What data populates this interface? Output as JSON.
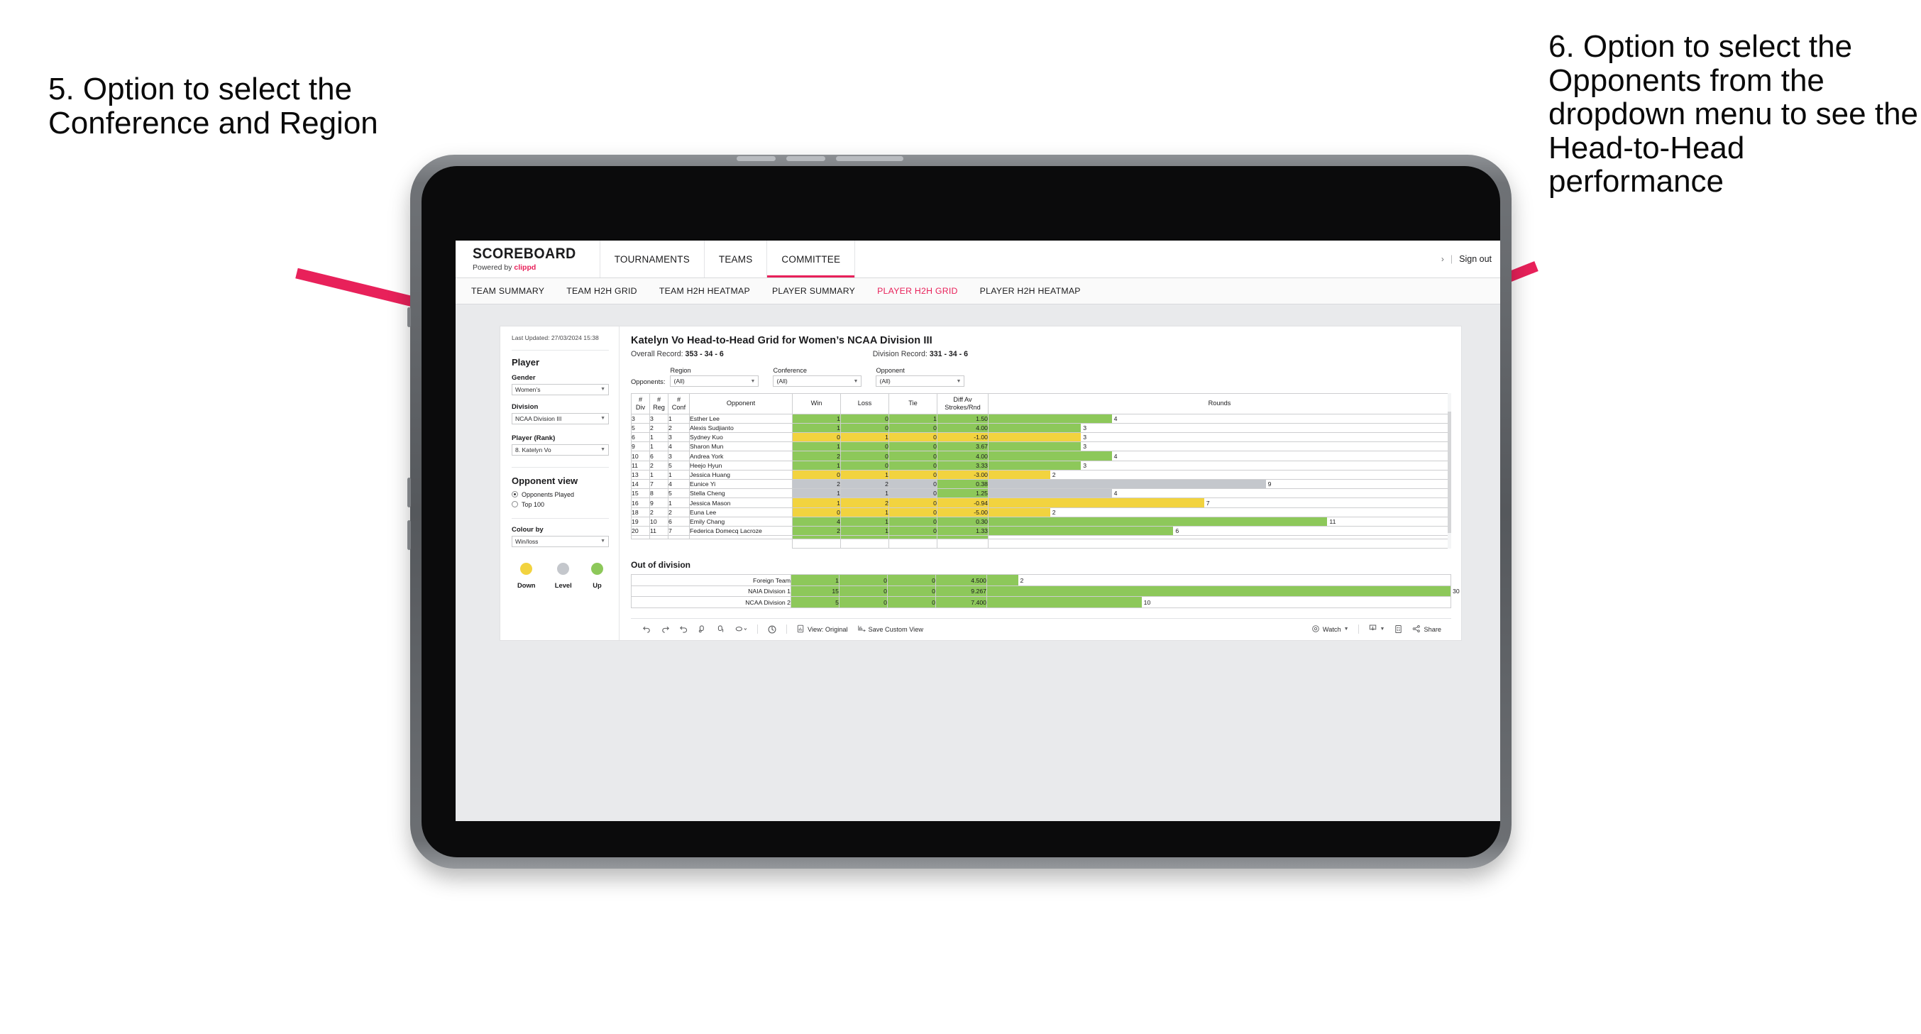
{
  "annotations": {
    "left": "5. Option to select the Conference and Region",
    "right": "6. Option to select the Opponents from the dropdown menu to see the Head-to-Head performance",
    "arrow_color": "#e8215a"
  },
  "header": {
    "brand_title": "SCOREBOARD",
    "brand_sub_prefix": "Powered by ",
    "brand_sub_accent": "clippd",
    "nav": [
      {
        "label": "TOURNAMENTS",
        "active": false
      },
      {
        "label": "TEAMS",
        "active": false
      },
      {
        "label": "COMMITTEE",
        "active": true
      }
    ],
    "user_caret": "›",
    "separator": "|",
    "sign_out": "Sign out"
  },
  "sub_nav": [
    {
      "label": "TEAM SUMMARY",
      "active": false
    },
    {
      "label": "TEAM H2H GRID",
      "active": false
    },
    {
      "label": "TEAM H2H HEATMAP",
      "active": false
    },
    {
      "label": "PLAYER SUMMARY",
      "active": false
    },
    {
      "label": "PLAYER H2H GRID",
      "active": true
    },
    {
      "label": "PLAYER H2H HEATMAP",
      "active": false
    }
  ],
  "panel": {
    "last_updated": "Last Updated: 27/03/2024 15:38",
    "section_player": "Player",
    "gender": {
      "label": "Gender",
      "value": "Women’s"
    },
    "division": {
      "label": "Division",
      "value": "NCAA Division III"
    },
    "player_rank": {
      "label": "Player (Rank)",
      "value": "8. Katelyn Vo"
    },
    "opponent_view": {
      "label": "Opponent view",
      "options": [
        {
          "label": "Opponents Played",
          "selected": true
        },
        {
          "label": "Top 100",
          "selected": false
        }
      ]
    },
    "colour_by": {
      "label": "Colour by",
      "value": "Win/loss"
    },
    "legend": [
      {
        "label": "Down",
        "color": "#f2d33f"
      },
      {
        "label": "Level",
        "color": "#c4c7cc"
      },
      {
        "label": "Up",
        "color": "#8dc85a"
      }
    ]
  },
  "viz": {
    "title": "Katelyn Vo Head-to-Head Grid for Women’s NCAA Division III",
    "overall_record_label": "Overall Record:",
    "overall_record_value": "353 -  34 - 6",
    "division_record_label": "Division Record:",
    "division_record_value": "331 -  34 - 6",
    "opponents_label": "Opponents:",
    "filters": [
      {
        "label": "Region",
        "value": "(All)"
      },
      {
        "label": "Conference",
        "value": "(All)"
      },
      {
        "label": "Opponent",
        "value": "(All)"
      }
    ]
  },
  "chart_data": {
    "type": "table",
    "title": "Katelyn Vo Head-to-Head Grid for Women’s NCAA Division III",
    "columns": [
      "# Div",
      "# Reg",
      "# Conf",
      "Opponent",
      "Win",
      "Loss",
      "Tie",
      "Diff Av Strokes/Rnd",
      "Rounds"
    ],
    "column_header_lines": [
      [
        "#",
        "Div"
      ],
      [
        "#",
        "Reg"
      ],
      [
        "#",
        "Conf"
      ],
      [
        "Opponent"
      ],
      [
        "Win"
      ],
      [
        "Loss"
      ],
      [
        "Tie"
      ],
      [
        "Diff Av",
        "Strokes/Rnd"
      ],
      [
        "Rounds"
      ]
    ],
    "rounds_max": 30,
    "rows": [
      {
        "div": "3",
        "reg": "3",
        "conf": "1",
        "opponent": "Esther Lee",
        "win": "1",
        "loss": "0",
        "tie": "1",
        "diff": "1.50",
        "rounds": "4",
        "status": "up"
      },
      {
        "div": "5",
        "reg": "2",
        "conf": "2",
        "opponent": "Alexis Sudjianto",
        "win": "1",
        "loss": "0",
        "tie": "0",
        "diff": "4.00",
        "rounds": "3",
        "status": "up"
      },
      {
        "div": "6",
        "reg": "1",
        "conf": "3",
        "opponent": "Sydney Kuo",
        "win": "0",
        "loss": "1",
        "tie": "0",
        "diff": "-1.00",
        "rounds": "3",
        "status": "down"
      },
      {
        "div": "9",
        "reg": "1",
        "conf": "4",
        "opponent": "Sharon Mun",
        "win": "1",
        "loss": "0",
        "tie": "0",
        "diff": "3.67",
        "rounds": "3",
        "status": "up"
      },
      {
        "div": "10",
        "reg": "6",
        "conf": "3",
        "opponent": "Andrea York",
        "win": "2",
        "loss": "0",
        "tie": "0",
        "diff": "4.00",
        "rounds": "4",
        "status": "up"
      },
      {
        "div": "11",
        "reg": "2",
        "conf": "5",
        "opponent": "Heejo Hyun",
        "win": "1",
        "loss": "0",
        "tie": "0",
        "diff": "3.33",
        "rounds": "3",
        "status": "up"
      },
      {
        "div": "13",
        "reg": "1",
        "conf": "1",
        "opponent": "Jessica Huang",
        "win": "0",
        "loss": "1",
        "tie": "0",
        "diff": "-3.00",
        "rounds": "2",
        "status": "down"
      },
      {
        "div": "14",
        "reg": "7",
        "conf": "4",
        "opponent": "Eunice Yi",
        "win": "2",
        "loss": "2",
        "tie": "0",
        "diff": "0.38",
        "rounds": "9",
        "status": "level",
        "diff_status": "up"
      },
      {
        "div": "15",
        "reg": "8",
        "conf": "5",
        "opponent": "Stella Cheng",
        "win": "1",
        "loss": "1",
        "tie": "0",
        "diff": "1.25",
        "rounds": "4",
        "status": "level",
        "diff_status": "up"
      },
      {
        "div": "16",
        "reg": "9",
        "conf": "1",
        "opponent": "Jessica Mason",
        "win": "1",
        "loss": "2",
        "tie": "0",
        "diff": "-0.94",
        "rounds": "7",
        "status": "down"
      },
      {
        "div": "18",
        "reg": "2",
        "conf": "2",
        "opponent": "Euna Lee",
        "win": "0",
        "loss": "1",
        "tie": "0",
        "diff": "-5.00",
        "rounds": "2",
        "status": "down"
      },
      {
        "div": "19",
        "reg": "10",
        "conf": "6",
        "opponent": "Emily Chang",
        "win": "4",
        "loss": "1",
        "tie": "0",
        "diff": "0.30",
        "rounds": "11",
        "status": "up"
      },
      {
        "div": "20",
        "reg": "11",
        "conf": "7",
        "opponent": "Federica Domecq Lacroze",
        "win": "2",
        "loss": "1",
        "tie": "0",
        "diff": "1.33",
        "rounds": "6",
        "status": "up"
      }
    ],
    "out_of_division": {
      "title": "Out of division",
      "rows": [
        {
          "opponent": "Foreign Team",
          "win": "1",
          "loss": "0",
          "tie": "0",
          "diff": "4.500",
          "rounds": "2",
          "status": "up"
        },
        {
          "opponent": "NAIA Division 1",
          "win": "15",
          "loss": "0",
          "tie": "0",
          "diff": "9.267",
          "rounds": "30",
          "status": "up"
        },
        {
          "opponent": "NCAA Division 2",
          "win": "5",
          "loss": "0",
          "tie": "0",
          "diff": "7.400",
          "rounds": "10",
          "status": "up"
        }
      ]
    },
    "colors": {
      "up": "#8dc85a",
      "down": "#f2d33f",
      "level": "#c4c7cc"
    }
  },
  "toolbar": {
    "view_label": "View: Original",
    "save_label": "Save Custom View",
    "watch_label": "Watch",
    "share_label": "Share"
  }
}
